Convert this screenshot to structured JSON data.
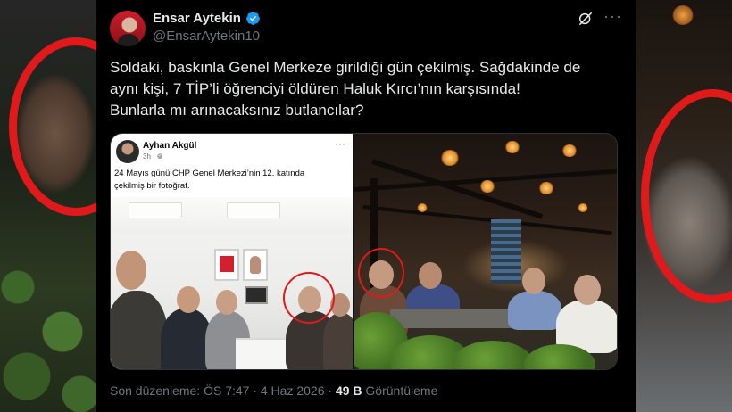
{
  "author": {
    "display_name": "Ensar Aytekin",
    "handle": "@EnsarAytekin10",
    "verified": true
  },
  "tweet": {
    "lines": [
      "Soldaki, baskınla Genel Merkeze girildiği gün çekilmiş. Sağdakinde de",
      "aynı kişi, 7 TİP’li öğrenciyi öldüren Haluk Kırcı’nın karşısında!",
      "Bunlarla mı arınacaksınız butlancılar?"
    ]
  },
  "embedded_post": {
    "name": "Ayhan Akgül",
    "time": "3h ·",
    "caption": "24 Mayıs günü CHP Genel Merkezi’nin 12. katında çekilmiş bir fotoğraf.",
    "more": "···"
  },
  "footer": {
    "edited_label": "Son düzenleme:",
    "timestamp": "ÖS 7:47 · 4 Haz 2026",
    "separator": " · ",
    "views_count": "49 B",
    "views_label": "Görüntüleme"
  },
  "icons": {
    "grok": "grok-icon",
    "more": "more-icon",
    "verified": "verified-badge-icon"
  },
  "colors": {
    "background": "#000000",
    "text": "#e7e9ea",
    "secondary": "#71767b",
    "verified": "#1d9bf0",
    "highlight_circle": "#e01a1a"
  }
}
